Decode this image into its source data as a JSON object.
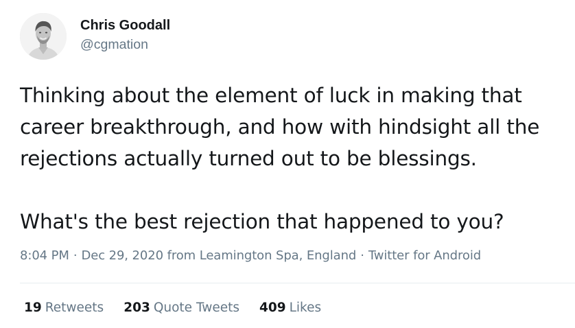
{
  "author": {
    "display_name": "Chris Goodall",
    "handle": "@cgmation",
    "avatar_icon": "profile-photo"
  },
  "tweet": {
    "paragraphs": [
      [
        "Thinking about the element of luck in making that",
        "career breakthrough, and how with hindsight all the",
        "rejections actually turned out to be blessings."
      ],
      [
        "What's the best rejection that happened to you?"
      ]
    ]
  },
  "meta": {
    "time": "8:04 PM",
    "date": "Dec 29, 2020",
    "location_prefix": "from",
    "location": "Leamington Spa, England",
    "source": "Twitter for Android",
    "separator": "·"
  },
  "stats": {
    "retweets": {
      "count": "19",
      "label": "Retweets"
    },
    "quotes": {
      "count": "203",
      "label": "Quote Tweets"
    },
    "likes": {
      "count": "409",
      "label": "Likes"
    }
  },
  "colors": {
    "text_primary": "#14171a",
    "text_secondary": "#657786",
    "divider": "#e6ecf0",
    "background": "#ffffff"
  }
}
